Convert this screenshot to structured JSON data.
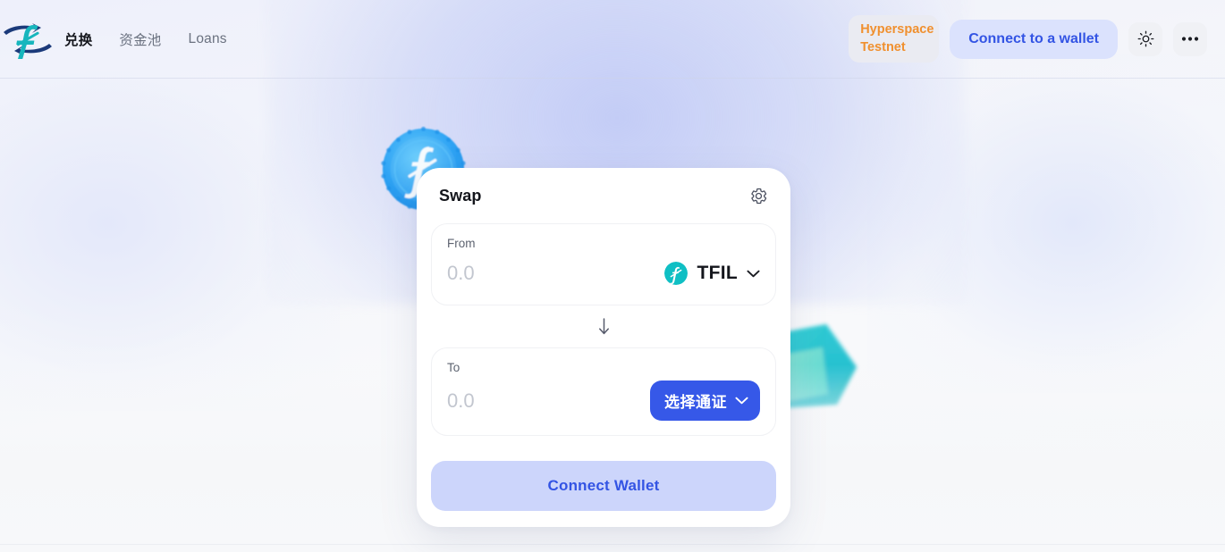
{
  "header": {
    "logo_icon": "filecoin-f-swoosh-logo",
    "nav": [
      {
        "label": "兑换",
        "active": true
      },
      {
        "label": "资金池",
        "active": false
      },
      {
        "label": "Loans",
        "active": false
      }
    ],
    "network": {
      "line1": "Hyperspace",
      "line2": "Testnet",
      "text_color": "#f0902f",
      "bg_color": "#eaebf2"
    },
    "connect_label": "Connect to a wallet",
    "connect_text_color": "#3354e4",
    "connect_bg_color": "#dbe2fd",
    "theme_toggle_icon": "sun-icon",
    "more_menu_icon": "ellipsis-icon"
  },
  "swap_card": {
    "title": "Swap",
    "settings_icon": "gear-icon",
    "from": {
      "label": "From",
      "amount_value": "",
      "amount_placeholder": "0.0",
      "token_symbol": "TFIL",
      "token_icon": "tfil-token-icon",
      "token_icon_color": "#0fbfc4",
      "chevron_icon": "chevron-down-icon"
    },
    "swap_direction_icon": "arrow-down-icon",
    "to": {
      "label": "To",
      "amount_value": "",
      "amount_placeholder": "0.0",
      "select_token_label": "选择通证",
      "select_token_bg": "#3658e8",
      "chevron_icon": "chevron-down-icon"
    },
    "action_label": "Connect Wallet",
    "action_bg": "#ccd5fb",
    "action_text_color": "#3354e4"
  },
  "decorations": {
    "coin_icon": "filecoin-coin-graphic",
    "coin_color": "#32a7f5",
    "gem_icon": "teal-gem-graphic",
    "gem_color": "#22c6cd"
  }
}
